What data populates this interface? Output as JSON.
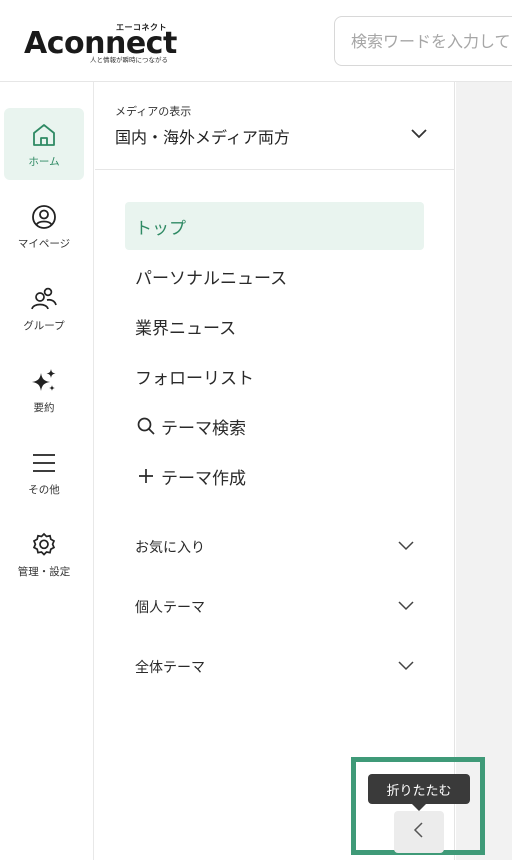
{
  "header": {
    "logo_kana": "エーコネクト",
    "logo_word": "Aconnect",
    "logo_tagline": "人と情報が瞬時につながる",
    "search_placeholder": "検索ワードを入力して"
  },
  "rail": {
    "items": [
      {
        "label": "ホーム",
        "icon": "home-icon",
        "active": true
      },
      {
        "label": "マイページ",
        "icon": "user-circle-icon"
      },
      {
        "label": "グループ",
        "icon": "group-icon"
      },
      {
        "label": "要約",
        "icon": "sparkle-icon"
      },
      {
        "label": "その他",
        "icon": "menu-icon"
      },
      {
        "label": "管理・設定",
        "icon": "gear-icon"
      }
    ]
  },
  "panel": {
    "media_caption": "メディアの表示",
    "media_value": "国内・海外メディア両方",
    "nav": [
      {
        "label": "トップ",
        "active": true
      },
      {
        "label": "パーソナルニュース"
      },
      {
        "label": "業界ニュース"
      },
      {
        "label": "フォローリスト"
      },
      {
        "label": "テーマ検索",
        "icon": "search-icon"
      },
      {
        "label": "テーマ作成",
        "icon": "plus-icon"
      }
    ],
    "sections": [
      {
        "label": "お気に入り"
      },
      {
        "label": "個人テーマ"
      },
      {
        "label": "全体テーマ"
      }
    ]
  },
  "collapse": {
    "tooltip": "折りたたむ"
  },
  "colors": {
    "accent": "#2f8a64",
    "accent_bg": "#e9f4ef",
    "highlight_border": "#3f9a78",
    "tooltip_bg": "#3a3a3a"
  }
}
